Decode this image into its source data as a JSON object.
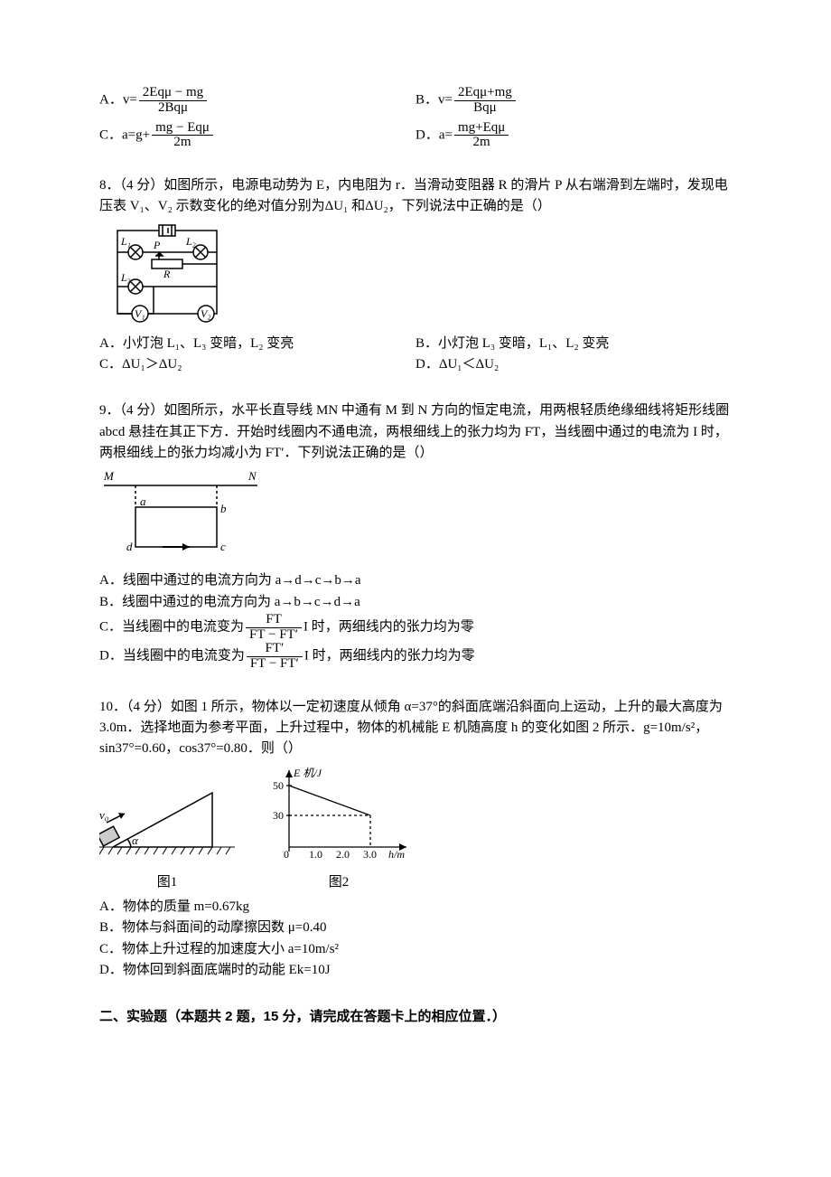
{
  "q7": {
    "A_pre": "A．v=",
    "A_num": "2Eqμ − mg",
    "A_den": "2Bqμ",
    "B_pre": "B．v=",
    "B_num": "2Eqμ+mg",
    "B_den": "Bqμ",
    "C_pre": "C．a=g+",
    "C_num": "mg − Eqμ",
    "C_den": "2m",
    "D_pre": "D．a=",
    "D_num": "mg+Eqμ",
    "D_den": "2m"
  },
  "q8": {
    "stem": "8．（4 分）如图所示，电源电动势为 E，内电阻为 r．当滑动变阻器 R 的滑片 P 从右端滑到左端时，发现电压表 V₁、V₂ 示数变化的绝对值分别为ΔU₁ 和ΔU₂，下列说法中正确的是（）",
    "diag": {
      "L1": "L₁",
      "L2": "L₂",
      "L3": "L₃",
      "P": "P",
      "R": "R",
      "V1": "V₁",
      "V2": "V₂"
    },
    "A": "A．小灯泡 L₁、L₃ 变暗，L₂ 变亮",
    "B": "B．小灯泡 L₃ 变暗，L₁、L₂ 变亮",
    "C": "C．ΔU₁＞ΔU₂",
    "D": "D．ΔU₁＜ΔU₂"
  },
  "q9": {
    "stem": "9．（4 分）如图所示，水平长直导线 MN 中通有 M 到 N 方向的恒定电流，用两根轻质绝缘细线将矩形线圈 abcd 悬挂在其正下方．开始时线圈内不通电流，两根细线上的张力均为 FT，当线圈中通过的电流为 I 时，两根细线上的张力均减小为 FT′．下列说法正确的是（）",
    "diag": {
      "M": "M",
      "N": "N",
      "a": "a",
      "b": "b",
      "c": "c",
      "d": "d"
    },
    "A": "A．线圈中通过的电流方向为 a→d→c→b→a",
    "B": "B．线圈中通过的电流方向为 a→b→c→d→a",
    "C_pre": "C．当线圈中的电流变为",
    "C_num": "FT",
    "C_den": "FT − FT′",
    "C_suf": "I 时，两细线内的张力均为零",
    "D_pre": "D．当线圈中的电流变为",
    "D_num": "FT′",
    "D_den": "FT − FT′",
    "D_suf": "I 时，两细线内的张力均为零"
  },
  "q10": {
    "stem": "10．（4 分）如图 1 所示，物体以一定初速度从倾角 α=37°的斜面底端沿斜面向上运动，上升的最大高度为 3.0m．选择地面为参考平面，上升过程中，物体的机械能 E 机随高度 h 的变化如图 2 所示．g=10m/s²，sin37°=0.60，cos37°=0.80．则（）",
    "fig1": {
      "v0": "v₀",
      "alpha": "α",
      "cap": "图1"
    },
    "fig2": {
      "yaxis": "E 机/J",
      "y50": "50",
      "y30": "30",
      "x0": "0",
      "x1": "1.0",
      "x2": "2.0",
      "x3": "3.0",
      "xaxis": "h/m",
      "cap": "图2"
    },
    "A": "A．物体的质量 m=0.67kg",
    "B": "B．物体与斜面间的动摩擦因数 μ=0.40",
    "C": "C．物体上升过程的加速度大小 a=10m/s²",
    "D": "D．物体回到斜面底端时的动能 Ek=10J"
  },
  "section2": "二、实验题（本题共 2 题，15 分，请完成在答题卡上的相应位置．）",
  "chart_data": {
    "type": "line",
    "title": "E机/J vs h/m",
    "xlabel": "h/m",
    "ylabel": "E机/J",
    "x": [
      0,
      3.0
    ],
    "values": [
      50,
      30
    ],
    "annotations": [
      {
        "x": 3.0,
        "y": 30,
        "note": "dashed guides to axes"
      }
    ],
    "xlim": [
      0,
      3.5
    ],
    "ylim": [
      0,
      55
    ],
    "xticks": [
      0,
      1.0,
      2.0,
      3.0
    ],
    "yticks": [
      30,
      50
    ]
  }
}
